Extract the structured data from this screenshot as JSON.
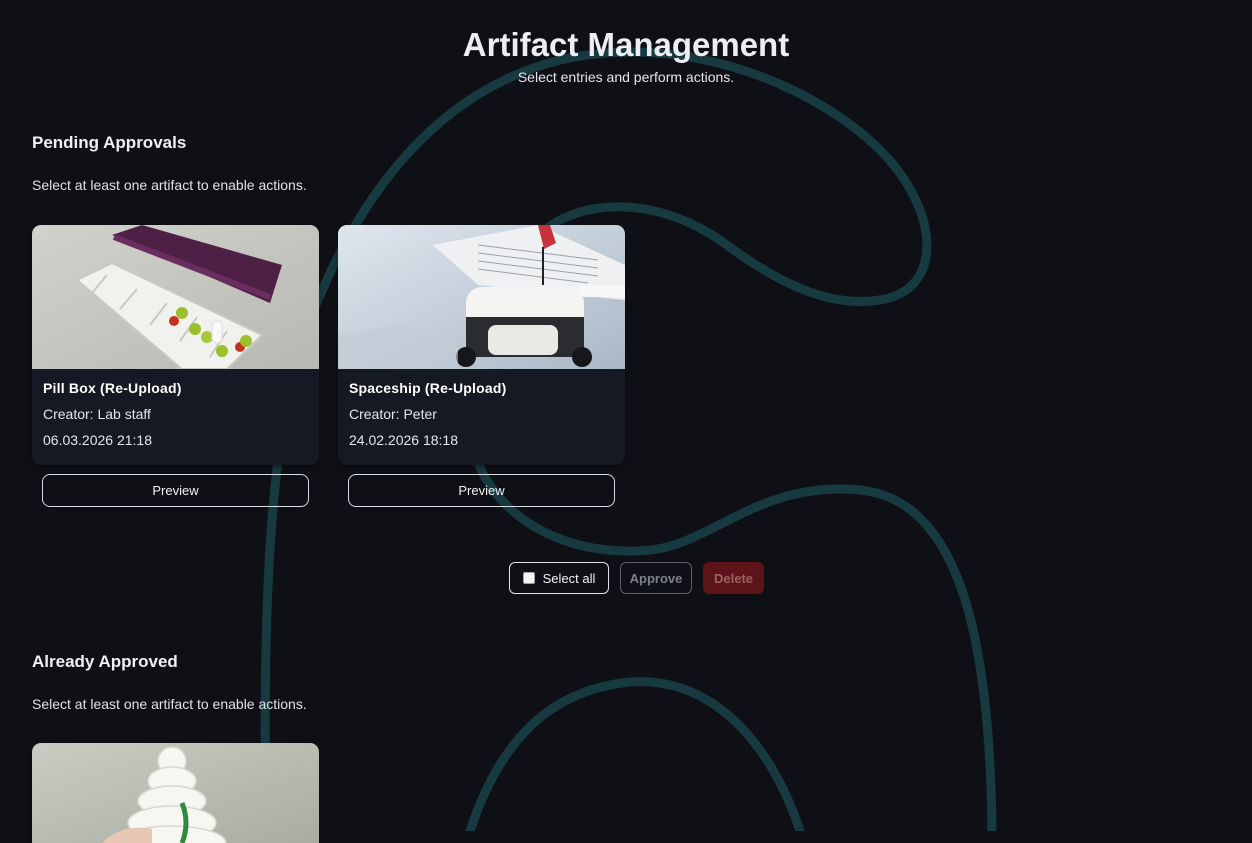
{
  "header": {
    "title": "Artifact Management",
    "subtitle": "Select entries and perform actions."
  },
  "pending": {
    "heading": "Pending Approvals",
    "hint": "Select at least one artifact to enable actions.",
    "items": [
      {
        "title": "Pill Box (Re-Upload)",
        "creator": "Creator: Lab staff",
        "date": "06.03.2026 21:18",
        "preview_label": "Preview"
      },
      {
        "title": "Spaceship (Re-Upload)",
        "creator": "Creator: Peter",
        "date": "24.02.2026 18:18",
        "preview_label": "Preview"
      }
    ]
  },
  "actions": {
    "select_all": "Select all",
    "approve": "Approve",
    "delete": "Delete"
  },
  "approved": {
    "heading": "Already Approved",
    "hint": "Select at least one artifact to enable actions."
  },
  "colors": {
    "background": "#0f1015",
    "card": "#151923",
    "accent_curve": "#173a40",
    "delete_disabled": "#5c1419"
  }
}
